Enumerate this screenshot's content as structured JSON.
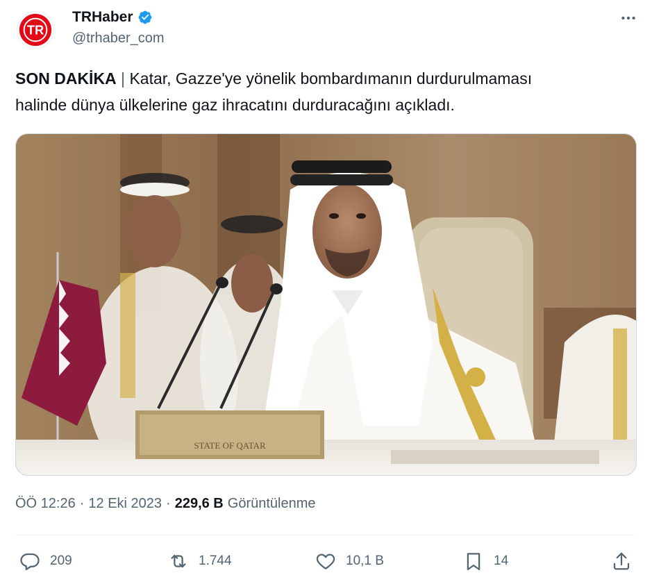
{
  "account": {
    "display_name": "TRHaber",
    "handle": "@trhaber_com",
    "avatar_text": "TR",
    "verified_icon": "verified-badge-icon",
    "brand_color": "#e30a17",
    "verified_color": "#1d9bf0"
  },
  "tweet": {
    "prefix": "SON DAKİKA",
    "separator": " | ",
    "text_line1": "Katar, Gazze'ye yönelik bombardımanın durdurulmaması",
    "text_line2": "halinde dünya ülkelerine gaz ihracatını durduracağını açıkladı."
  },
  "media": {
    "nameplate_text": "STATE OF QATAR"
  },
  "meta": {
    "time": "ÖÖ 12:26",
    "separator": "·",
    "date": "12 Eki 2023",
    "views_count": "229,6 B",
    "views_label": "Görüntülenme"
  },
  "actions": {
    "replies": "209",
    "retweets": "1.744",
    "likes": "10,1 B",
    "bookmarks": "14"
  },
  "colors": {
    "text_primary": "#0f1419",
    "text_secondary": "#536471",
    "divider": "#eff3f4"
  }
}
